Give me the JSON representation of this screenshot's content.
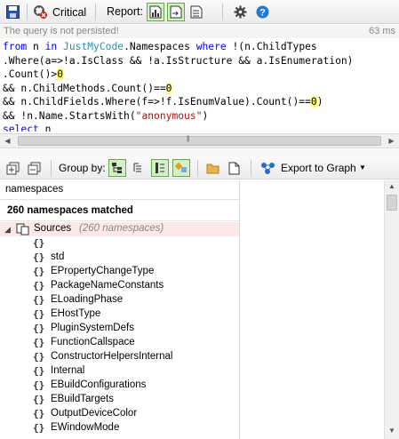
{
  "toolbar": {
    "save_icon": "save-icon",
    "critical_label": "Critical",
    "report_label": "Report:"
  },
  "status": {
    "message": "The query is not persisted!",
    "duration": "63 ms"
  },
  "query": {
    "lines": [
      "from n in JustMyCode.Namespaces where !(n.ChildTypes",
      ".Where(a=>!a.IsClass && !a.IsStructure && a.IsEnumeration)",
      ".Count()>0",
      "&& n.ChildMethods.Count()==0",
      "&& n.ChildFields.Where(f=>!f.IsEnumValue).Count()==0)",
      "&& !n.Name.StartsWith(\"anonymous\")",
      "select n"
    ]
  },
  "results_toolbar": {
    "group_by_label": "Group by:",
    "export_label": "Export to Graph"
  },
  "results": {
    "column_header": "namespaces",
    "summary": "260 namespaces matched",
    "group": {
      "name": "Sources",
      "count": "(260 namespaces)"
    },
    "items": [
      "",
      "std",
      "EPropertyChangeType",
      "PackageNameConstants",
      "ELoadingPhase",
      "EHostType",
      "PluginSystemDefs",
      "FunctionCallspace",
      "ConstructorHelpersInternal",
      "Internal",
      "EBuildConfigurations",
      "EBuildTargets",
      "OutputDeviceColor",
      "EWindowMode"
    ],
    "item_icon": "{}"
  },
  "colors": {
    "keyword": "#0000ff",
    "type": "#2b91af",
    "string": "#a31515",
    "number_highlight": "#ffff80",
    "group_row": "#fde8e8"
  }
}
